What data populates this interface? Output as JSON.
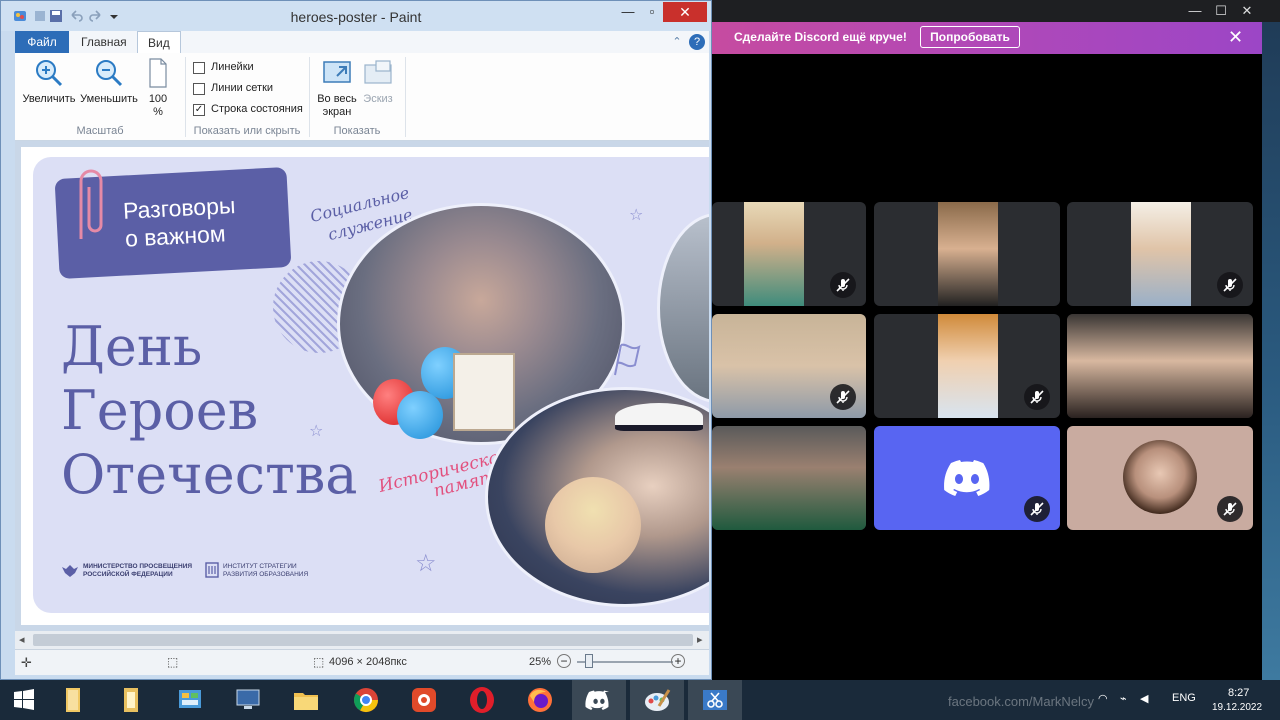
{
  "paint": {
    "title": "heroes-poster - Paint",
    "tabs": {
      "file": "Файл",
      "home": "Главная",
      "view": "Вид"
    },
    "ribbon": {
      "zoom_in": "Увеличить",
      "zoom_out": "Уменьшить",
      "zoom_100_line1": "100",
      "zoom_100_line2": "%",
      "group_zoom": "Масштаб",
      "rulers": "Линейки",
      "gridlines": "Линии сетки",
      "statusbar": "Строка состояния",
      "group_showhide": "Показать или скрыть",
      "fullscreen_line1": "Во весь",
      "fullscreen_line2": "экран",
      "thumbnail": "Эскиз",
      "group_display": "Показать"
    },
    "status": {
      "size": "4096 × 2048пкс",
      "zoom": "25%",
      "zoom_minus": "−",
      "zoom_plus": "+"
    }
  },
  "poster": {
    "badge_line1": "Разговоры",
    "badge_line2": "о важном",
    "script_top_line1": "Социальное",
    "script_top_line2": "служение",
    "title_line1": "День",
    "title_line2": "Героев",
    "title_line3": "Отечества",
    "script_bottom_line1": "Историческая",
    "script_bottom_line2": "память",
    "logo1_line1": "МИНИСТЕРСТВО ПРОСВЕЩЕНИЯ",
    "logo1_line2": "РОССИЙСКОЙ ФЕДЕРАЦИИ",
    "logo2_line1": "ИНСТИТУТ СТРАТЕГИИ",
    "logo2_line2": "РАЗВИТИЯ ОБРАЗОВАНИЯ"
  },
  "discord": {
    "nitro_text": "Сделайте Discord ещё круче!",
    "nitro_button": "Попробовать",
    "nitro_close": "✕",
    "window_min": "—",
    "window_max": "☐",
    "window_close": "✕"
  },
  "taskbar": {
    "lang": "ENG",
    "time": "8:27",
    "date": "19.12.2022"
  },
  "watermark": "facebook.com/MarkNelcy"
}
